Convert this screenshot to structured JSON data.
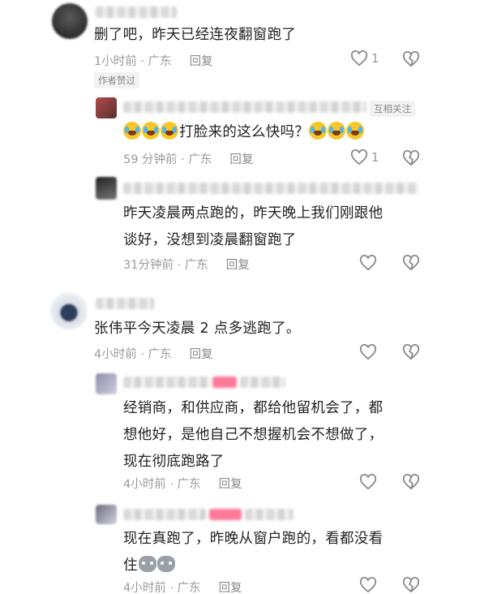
{
  "comments": [
    {
      "text": "删了吧，昨天已经连夜翻窗跑了",
      "time": "1小时前 · 广东",
      "reply": "回复",
      "likes": "1",
      "badge": "作者赞过"
    },
    {
      "text_prefix": "",
      "text": "打脸来的这么快吗？",
      "time": "59 分钟前 · 广东",
      "reply": "回复",
      "likes": "1",
      "badge": "互相关注"
    },
    {
      "line1": "昨天凌晨两点跑的，昨天晚上我们刚跟他",
      "line2": "谈好，没想到凌晨翻窗跑了",
      "time": "31分钟前 · 广东",
      "reply": "回复"
    },
    {
      "text": "张伟平今天凌晨 2 点多逃跑了。",
      "time": "4小时前 · 广东",
      "reply": "回复"
    },
    {
      "line1": "经销商，和供应商，都给他留机会了，都",
      "line2": "想他好，是他自己不想握机会不想做了，",
      "line3": "现在彻底跑路了",
      "time": "4小时前 · 广东",
      "reply": "回复"
    },
    {
      "line1": "现在真跑了，昨晚从窗户跑的，看都没看",
      "line2": "住",
      "time": "4小时前 · 广东",
      "reply": "回复"
    }
  ],
  "icons": {
    "like": "heart-outline-icon",
    "dislike": "broken-heart-icon",
    "laugh": "laugh-cry-emoji",
    "cat": "cat-emoji"
  }
}
